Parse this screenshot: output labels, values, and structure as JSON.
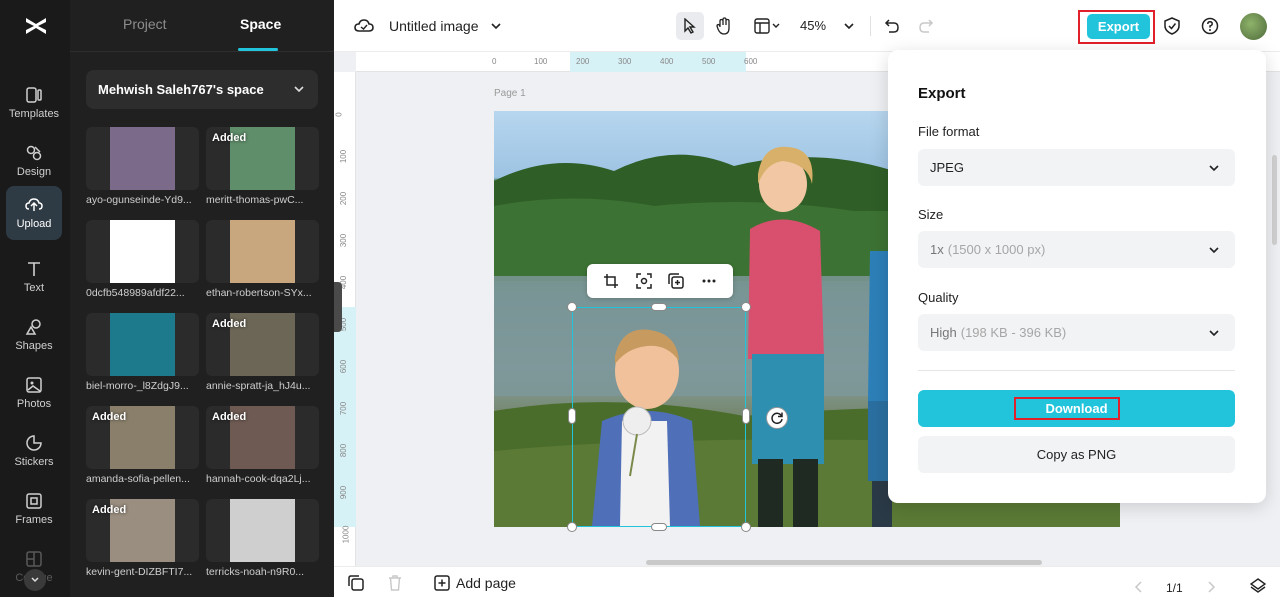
{
  "rail": {
    "items": [
      {
        "label": "Templates",
        "icon": "templates-icon"
      },
      {
        "label": "Design",
        "icon": "design-icon"
      },
      {
        "label": "Upload",
        "icon": "upload-icon",
        "active": true
      },
      {
        "label": "Text",
        "icon": "text-icon"
      },
      {
        "label": "Shapes",
        "icon": "shapes-icon"
      },
      {
        "label": "Photos",
        "icon": "photos-icon"
      },
      {
        "label": "Stickers",
        "icon": "stickers-icon"
      },
      {
        "label": "Frames",
        "icon": "frames-icon"
      },
      {
        "label": "Collage",
        "icon": "collage-icon"
      }
    ]
  },
  "panel": {
    "tabs": [
      "Project",
      "Space"
    ],
    "active_tab": "Space",
    "space_name": "Mehwish Saleh767's space",
    "assets": [
      {
        "caption": "ayo-ogunseinde-Yd9...",
        "added": false,
        "color": "#7b6a8a"
      },
      {
        "caption": "meritt-thomas-pwC...",
        "added": true,
        "badge": "Added",
        "color": "#5f8e6a"
      },
      {
        "caption": "0dcfb548989afdf22...",
        "added": false,
        "color": "#ffffff"
      },
      {
        "caption": "ethan-robertson-SYx...",
        "added": false,
        "color": "#c9a77e"
      },
      {
        "caption": "biel-morro-_l8ZdgJ9...",
        "added": false,
        "color": "#1c7a8c"
      },
      {
        "caption": "annie-spratt-ja_hJ4u...",
        "added": true,
        "badge": "Added",
        "color": "#6c6656"
      },
      {
        "caption": "amanda-sofia-pellen...",
        "added": true,
        "badge": "Added",
        "color": "#8a7f6b"
      },
      {
        "caption": "hannah-cook-dqa2Lj...",
        "added": true,
        "badge": "Added",
        "color": "#6e5a52"
      },
      {
        "caption": "kevin-gent-DIZBFTI7...",
        "added": true,
        "badge": "Added",
        "color": "#9a8e80"
      },
      {
        "caption": "terricks-noah-n9R0...",
        "added": false,
        "color": "#cfcfcf"
      }
    ]
  },
  "topbar": {
    "title": "Untitled image",
    "zoom": "45%",
    "export_label": "Export"
  },
  "canvas": {
    "page_label": "Page 1",
    "ruler_top": [
      "0",
      "100",
      "200",
      "300",
      "400",
      "500",
      "600"
    ],
    "ruler_left": [
      "0",
      "100",
      "200",
      "300",
      "400",
      "500",
      "600",
      "700",
      "800",
      "900",
      "1000"
    ]
  },
  "bottombar": {
    "add_page": "Add page",
    "page_indicator": "1/1"
  },
  "export_panel": {
    "title": "Export",
    "file_format_label": "File format",
    "file_format_value": "JPEG",
    "size_label": "Size",
    "size_value": "1x",
    "size_detail": "(1500 x 1000 px)",
    "quality_label": "Quality",
    "quality_value": "High",
    "quality_detail": "(198 KB - 396 KB)",
    "download_label": "Download",
    "copy_label": "Copy as PNG"
  },
  "colors": {
    "accent": "#22c4dc",
    "highlight": "#e0202a",
    "rail_bg": "#1a1a1a",
    "panel_bg": "#202020"
  }
}
